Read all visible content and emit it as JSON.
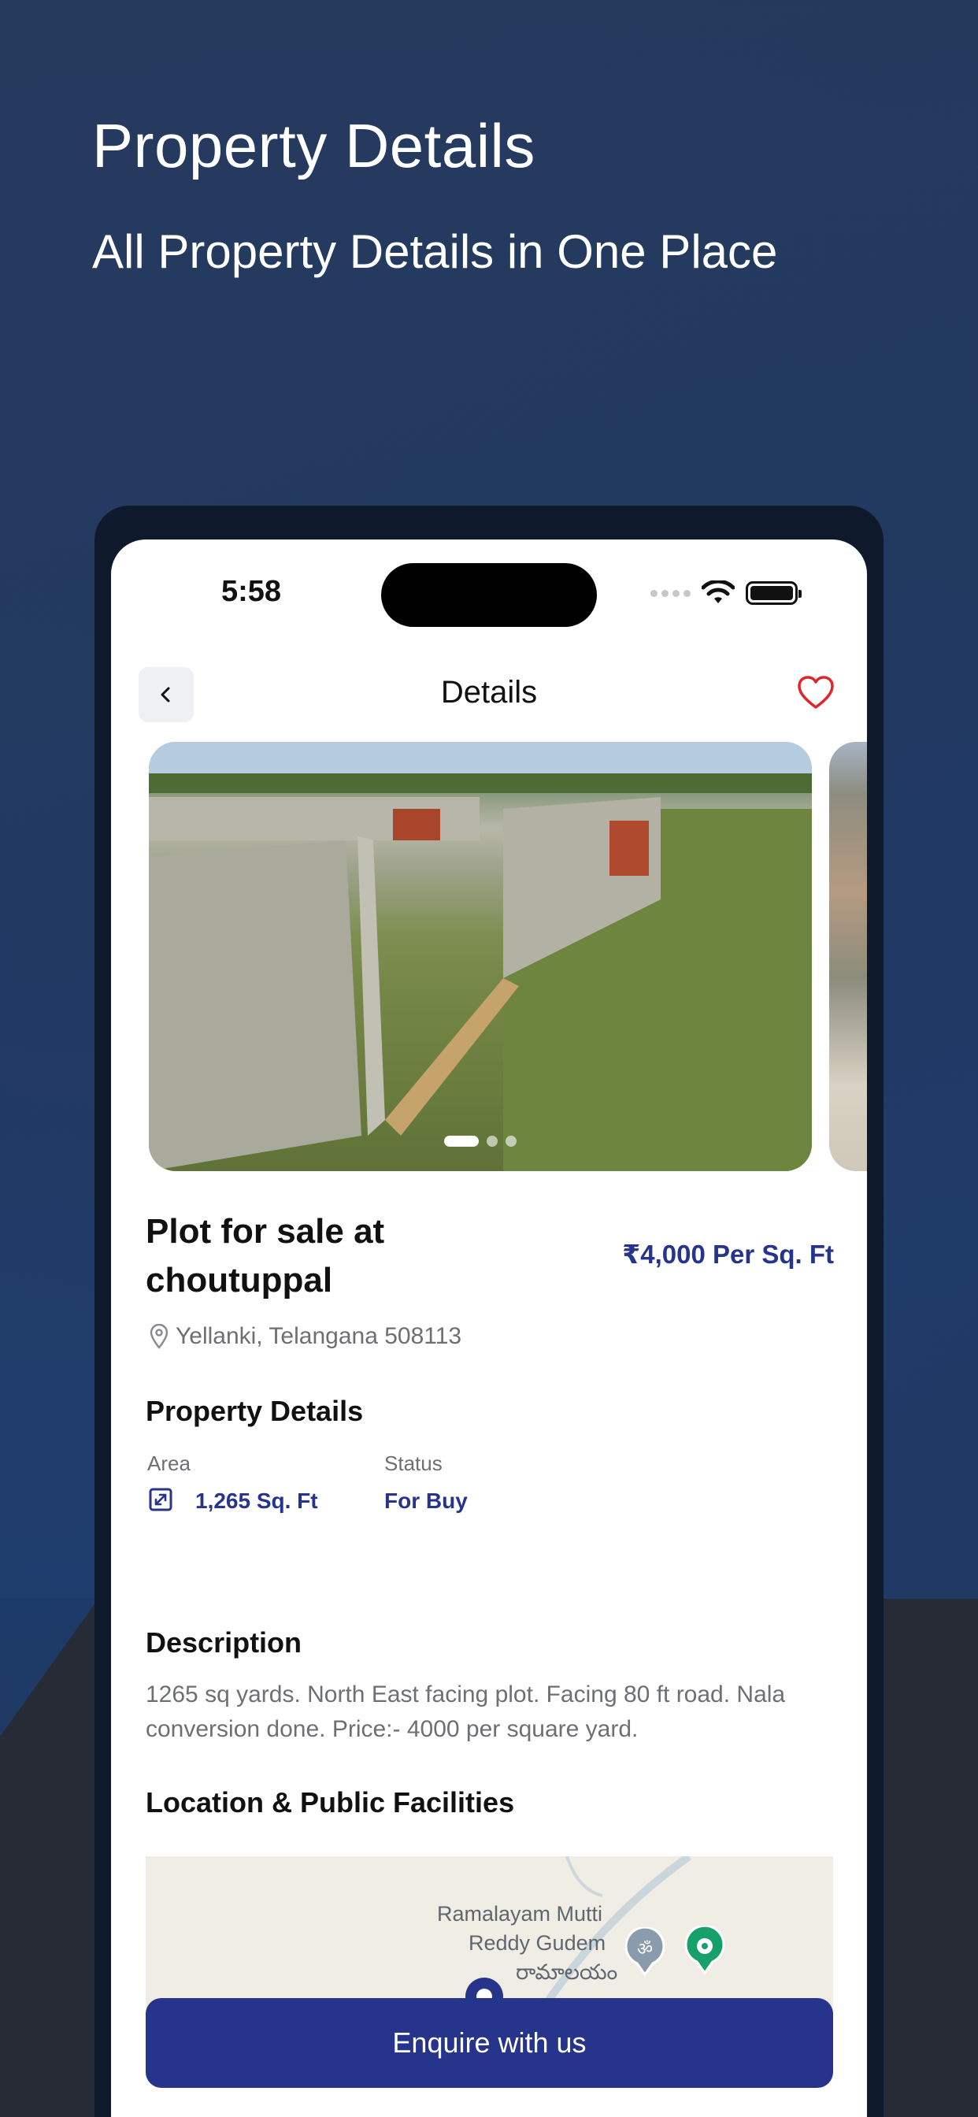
{
  "hero": {
    "title": "Property Details",
    "subtitle": "All Property Details in One Place"
  },
  "status_bar": {
    "time": "5:58"
  },
  "header": {
    "title": "Details",
    "back_icon": "chevron-left-icon",
    "favorite_icon": "heart-outline-icon"
  },
  "gallery": {
    "image_count": 3,
    "active_index": 0
  },
  "property": {
    "title": "Plot for sale at choutuppal",
    "price": "₹4,000 Per Sq. Ft",
    "address": "Yellanki, Telangana 508113"
  },
  "details": {
    "heading": "Property Details",
    "area_label": "Area",
    "area_value": "1,265 Sq. Ft",
    "status_label": "Status",
    "status_value": "For Buy"
  },
  "description": {
    "heading": "Description",
    "text": "1265 sq yards. North East facing plot. Facing 80 ft road. Nala conversion done. Price:- 4000 per square yard."
  },
  "location": {
    "heading": "Location & Public Facilities",
    "map_label_line1": "Ramalayam Mutti",
    "map_label_line2": "Reddy Gudem",
    "map_label_telugu": "రామాలయం"
  },
  "cta": {
    "label": "Enquire with us"
  },
  "colors": {
    "accent": "#27348b",
    "favorite": "#e0262b"
  }
}
